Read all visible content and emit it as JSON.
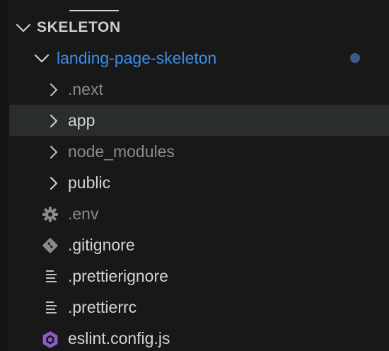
{
  "section": {
    "title": "SKELETON"
  },
  "root_folder": {
    "name": "landing-page-skeleton"
  },
  "items": [
    {
      "name": ".next",
      "kind": "folder",
      "style": "dim",
      "icon": "chevron-right-icon"
    },
    {
      "name": "app",
      "kind": "folder",
      "style": "bright",
      "icon": "chevron-right-icon",
      "selected": true
    },
    {
      "name": "node_modules",
      "kind": "folder",
      "style": "dim",
      "icon": "chevron-right-icon"
    },
    {
      "name": "public",
      "kind": "folder",
      "style": "bright",
      "icon": "chevron-right-icon"
    },
    {
      "name": ".env",
      "kind": "file",
      "style": "dim",
      "icon": "gear-icon"
    },
    {
      "name": ".gitignore",
      "kind": "file",
      "style": "bright",
      "icon": "git-icon"
    },
    {
      "name": ".prettierignore",
      "kind": "file",
      "style": "bright",
      "icon": "lines-icon"
    },
    {
      "name": ".prettierrc",
      "kind": "file",
      "style": "bright",
      "icon": "lines-icon"
    },
    {
      "name": "eslint.config.js",
      "kind": "file",
      "style": "bright",
      "icon": "eslint-icon"
    }
  ],
  "colors": {
    "background": "#181818",
    "root_folder": "#3b8eea",
    "selection": "#2a2d2e",
    "modified_dot": "#3a5a8c",
    "eslint_icon": "#8b5cc7"
  }
}
